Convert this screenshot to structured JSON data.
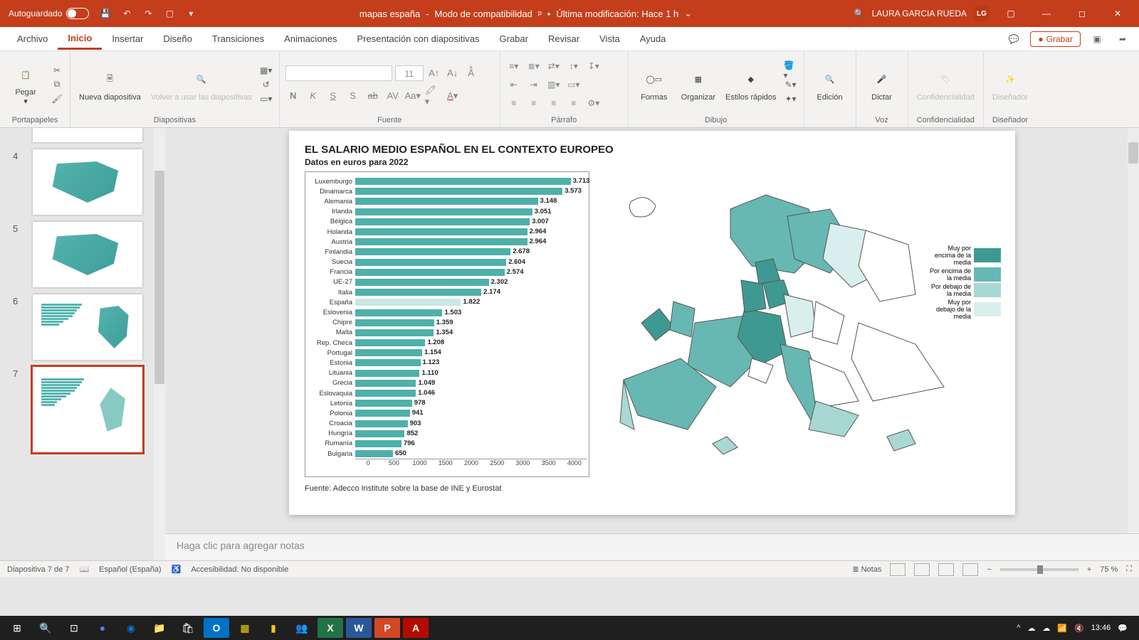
{
  "titlebar": {
    "autosave_label": "Autoguardado",
    "doc_name": "mapas españa",
    "mode": "Modo de compatibilidad",
    "last_mod": "Última modificación: Hace 1 h",
    "user": "LAURA GARCIA RUEDA",
    "initials": "LG"
  },
  "tabs": {
    "archivo": "Archivo",
    "inicio": "Inicio",
    "insertar": "Insertar",
    "diseno": "Diseño",
    "transiciones": "Transiciones",
    "animaciones": "Animaciones",
    "presentacion": "Presentación con diapositivas",
    "grabar": "Grabar",
    "revisar": "Revisar",
    "vista": "Vista",
    "ayuda": "Ayuda",
    "record_btn": "Grabar"
  },
  "ribbon": {
    "pegar": "Pegar",
    "portapapeles": "Portapapeles",
    "nueva": "Nueva diapositiva",
    "volver": "Volver a usar las diapositivas",
    "diapositivas": "Diapositivas",
    "font_size": "11",
    "fuente": "Fuente",
    "parrafo": "Párrafo",
    "formas": "Formas",
    "organizar": "Organizar",
    "estilos": "Estilos rápidos",
    "dibujo": "Dibujo",
    "edicion": "Edición",
    "dictar": "Dictar",
    "voz": "Voz",
    "confidencialidad": "Confidencialidad",
    "disenador": "Diseñador"
  },
  "thumbs": [
    "4",
    "5",
    "6",
    "7"
  ],
  "slide": {
    "title": "EL SALARIO MEDIO ESPAÑOL EN EL CONTEXTO EUROPEO",
    "subtitle": "Datos en euros para 2022",
    "source": "Fuente: Adecco Institute sobre la base de INE y Eurostat",
    "x_ticks": [
      "0",
      "500",
      "1000",
      "1500",
      "2000",
      "2500",
      "3000",
      "3500",
      "4000"
    ],
    "x_max": 4000,
    "legend": [
      {
        "label": "Muy por encima de la media",
        "color": "#3f9993"
      },
      {
        "label": "Por encima de la media",
        "color": "#67b8b2"
      },
      {
        "label": "Por debajo de la media",
        "color": "#a8d8d4"
      },
      {
        "label": "Muy por debajo de la media",
        "color": "#d9efed"
      }
    ]
  },
  "chart_data": {
    "type": "bar",
    "title": "EL SALARIO MEDIO ESPAÑOL EN EL CONTEXTO EUROPEO",
    "subtitle": "Datos en euros para 2022",
    "xlabel": "",
    "ylabel": "",
    "xlim": [
      0,
      4000
    ],
    "highlight": "España",
    "series": [
      {
        "name": "Luxemburgo",
        "value": 3713
      },
      {
        "name": "Dinamarca",
        "value": 3573
      },
      {
        "name": "Alemania",
        "value": 3148
      },
      {
        "name": "Irlanda",
        "value": 3051
      },
      {
        "name": "Bélgica",
        "value": 3007
      },
      {
        "name": "Holanda",
        "value": 2964
      },
      {
        "name": "Austria",
        "value": 2964
      },
      {
        "name": "Finlandia",
        "value": 2678
      },
      {
        "name": "Suecia",
        "value": 2604
      },
      {
        "name": "Francia",
        "value": 2574
      },
      {
        "name": "UE-27",
        "value": 2302
      },
      {
        "name": "Italia",
        "value": 2174
      },
      {
        "name": "España",
        "value": 1822
      },
      {
        "name": "Eslovenia",
        "value": 1503
      },
      {
        "name": "Chipre",
        "value": 1359
      },
      {
        "name": "Malta",
        "value": 1354
      },
      {
        "name": "Rep. Checa",
        "value": 1208
      },
      {
        "name": "Portugal",
        "value": 1154
      },
      {
        "name": "Estonia",
        "value": 1123
      },
      {
        "name": "Lituania",
        "value": 1110
      },
      {
        "name": "Grecia",
        "value": 1049
      },
      {
        "name": "Eslovaquia",
        "value": 1046
      },
      {
        "name": "Letonia",
        "value": 978
      },
      {
        "name": "Polonia",
        "value": 941
      },
      {
        "name": "Croacia",
        "value": 903
      },
      {
        "name": "Hungría",
        "value": 852
      },
      {
        "name": "Rumanía",
        "value": 796
      },
      {
        "name": "Bulgaria",
        "value": 650
      }
    ]
  },
  "notes_placeholder": "Haga clic para agregar notas",
  "status": {
    "slide_of": "Diapositiva 7 de 7",
    "lang": "Español (España)",
    "access": "Accesibilidad: No disponible",
    "notas": "Notas",
    "zoom": "75 %"
  },
  "taskbar": {
    "time": "13:46"
  }
}
